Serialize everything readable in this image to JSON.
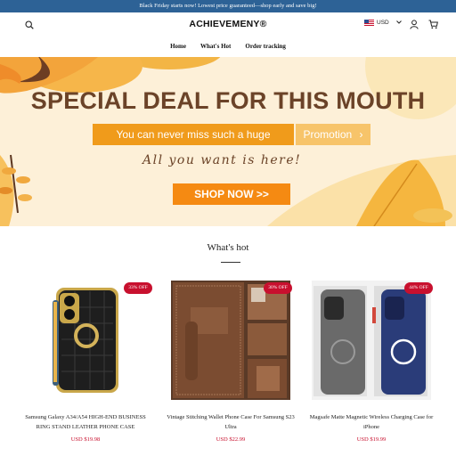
{
  "announcement": "Black Friday starts now! Lowest price guaranteed—shop early and save big!",
  "header": {
    "logo": "ACHIEVEMENY®",
    "currency": "USD",
    "icons": [
      "search-icon",
      "user-icon",
      "cart-icon",
      "us-flag-icon",
      "chevron-down-icon"
    ]
  },
  "nav": [
    "Home",
    "What's Hot",
    "Order tracking"
  ],
  "banner": {
    "headline": "SPECIAL DEAL FOR THIS MOUTH",
    "tagline": "You can never miss such a huge",
    "promotion": "Promotion",
    "promotion_arrow": "›",
    "script_text": "All you want is here!",
    "shop_button": "SHOP NOW >>"
  },
  "section": {
    "title": "What's hot"
  },
  "products": [
    {
      "badge": "33% OFF",
      "name": "Samsung Galaxy A34/A54 HIGH-END BUSINESS RING STAND LEATHER PHONE CASE",
      "price": "USD $19.98"
    },
    {
      "badge": "30% OFF",
      "name": "Vintage Stitching Wallet Phone Case For Samsung S23 Ultra",
      "price": "USD $22.99"
    },
    {
      "badge": "44% OFF",
      "name": "Magsafe Matte Magnetic Wireless Charging Case for iPhone",
      "price": "USD $19.99"
    }
  ],
  "colors": {
    "announcement_bg": "#2d6296",
    "banner_bg": "#fdf0d8",
    "headline": "#6b4328",
    "tag_orange": "#f09b1b",
    "promo_tag": "#f7c46a",
    "shop_button": "#f58a12",
    "badge": "#c8102e",
    "price": "#c8102e"
  }
}
